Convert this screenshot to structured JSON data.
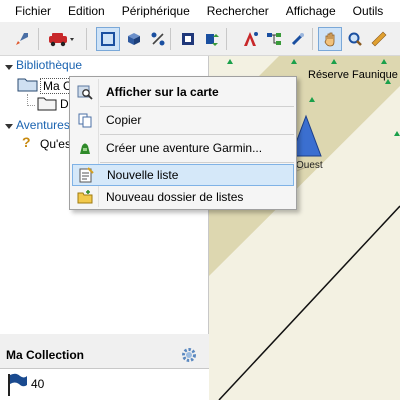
{
  "menubar": {
    "items": [
      "Fichier",
      "Edition",
      "Périphérique",
      "Rechercher",
      "Affichage",
      "Outils"
    ]
  },
  "tree": {
    "library_label": "Bibliothèque",
    "collection_label": "Ma Co",
    "folder_label": "D",
    "adventures_label": "Aventures",
    "question_label": "Qu'es"
  },
  "collection": {
    "title": "Ma Collection",
    "count": "40"
  },
  "map": {
    "place_label": "Réserve Faunique I",
    "marker_label": "Ouest"
  },
  "context_menu": {
    "items": [
      {
        "label": "Afficher sur la carte",
        "icon": "map-search-icon"
      },
      {
        "label": "Copier",
        "icon": "copy-icon"
      },
      {
        "label": "Créer une aventure Garmin...",
        "icon": "garmin-adventure-icon"
      },
      {
        "label": "Nouvelle liste",
        "icon": "new-list-icon"
      },
      {
        "label": "Nouveau dossier de listes",
        "icon": "new-folder-icon"
      }
    ],
    "highlighted": "Nouvelle liste"
  },
  "colors": {
    "link_blue": "#1a63b0",
    "highlight": "#d5e8f9",
    "map_bg": "#f3f1e2",
    "map_band": "#ddd7b0"
  }
}
